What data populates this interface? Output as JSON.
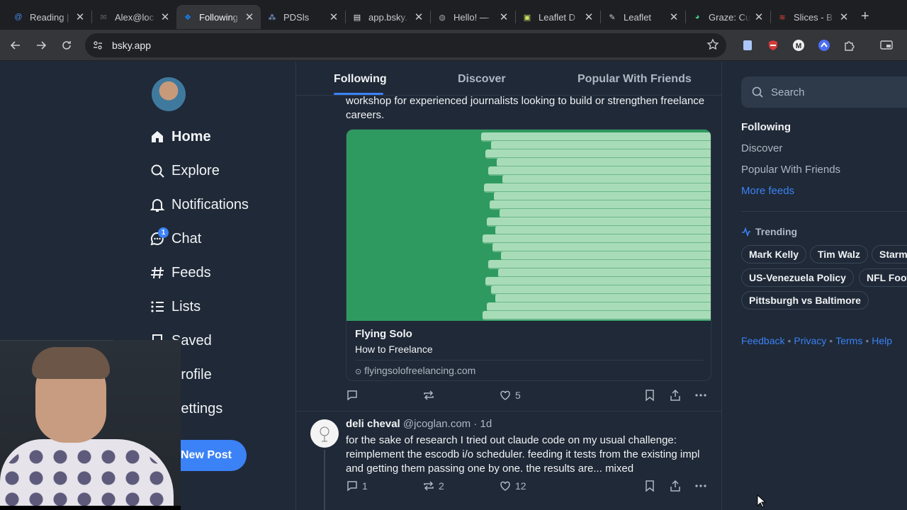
{
  "browser": {
    "tabs": [
      {
        "title": "Reading |",
        "icon": "at-icon",
        "color": "#4a8af4"
      },
      {
        "title": "Alex@loc",
        "icon": "mail-icon",
        "color": "#5f6368"
      },
      {
        "title": "Following",
        "icon": "butterfly-icon",
        "color": "#1185fe",
        "active": true
      },
      {
        "title": "PDSls",
        "icon": "nodes-icon",
        "color": "#8ab4f8"
      },
      {
        "title": "app.bsky.",
        "icon": "doc-icon",
        "color": "#e8eaed"
      },
      {
        "title": "Hello! —",
        "icon": "globe-icon",
        "color": "#9aa0a6"
      },
      {
        "title": "Leaflet D",
        "icon": "leaf-note-icon",
        "color": "#c9e265"
      },
      {
        "title": "Leaflet",
        "icon": "feather-icon",
        "color": "#c8cace"
      },
      {
        "title": "Graze: Cu",
        "icon": "graze-icon",
        "color": "#3ecf8e"
      },
      {
        "title": "Slices - B",
        "icon": "slices-icon",
        "color": "#e0463a"
      }
    ],
    "url": "bsky.app"
  },
  "sidebar": {
    "items": [
      {
        "label": "Home",
        "icon": "home-icon",
        "active": true
      },
      {
        "label": "Explore",
        "icon": "search-icon"
      },
      {
        "label": "Notifications",
        "icon": "bell-icon"
      },
      {
        "label": "Chat",
        "icon": "chat-icon",
        "badge": "1"
      },
      {
        "label": "Feeds",
        "icon": "hash-icon"
      },
      {
        "label": "Lists",
        "icon": "list-icon"
      },
      {
        "label": "Saved",
        "icon": "bookmark-icon"
      },
      {
        "label": "Profile",
        "icon": "profile-icon"
      },
      {
        "label": "Settings",
        "icon": "gear-icon"
      }
    ],
    "new_post_label": "New Post"
  },
  "feed_tabs": [
    "Following",
    "Discover",
    "Popular With Friends"
  ],
  "post1": {
    "text": "workshop for experienced journalists looking to build or strengthen freelance careers.",
    "card": {
      "title": "Flying Solo",
      "description": "How to Freelance",
      "domain": "flyingsolofreelancing.com"
    },
    "counts": {
      "reply": "",
      "repost": "",
      "like": "5"
    }
  },
  "post2": {
    "author": "deli cheval",
    "handle": "@jcoglan.com",
    "time": "· 1d",
    "text": "for the sake of research I tried out claude code on my usual challenge: reimplement the escodb i/o scheduler. feeding it tests from the existing impl and getting them passing one by one. the results are... mixed",
    "counts": {
      "reply": "1",
      "repost": "2",
      "like": "12"
    }
  },
  "right": {
    "search_placeholder": "Search",
    "feeds": [
      "Following",
      "Discover",
      "Popular With Friends",
      "More feeds"
    ],
    "trending_label": "Trending",
    "trending": [
      "Mark Kelly",
      "Tim Walz",
      "Starm",
      "US-Venezuela Policy",
      "NFL Foot",
      "Pittsburgh vs Baltimore"
    ],
    "footer": [
      "Feedback",
      "Privacy",
      "Terms",
      "Help"
    ]
  },
  "colors": {
    "accent": "#3b82f6",
    "background": "#1f2937"
  }
}
